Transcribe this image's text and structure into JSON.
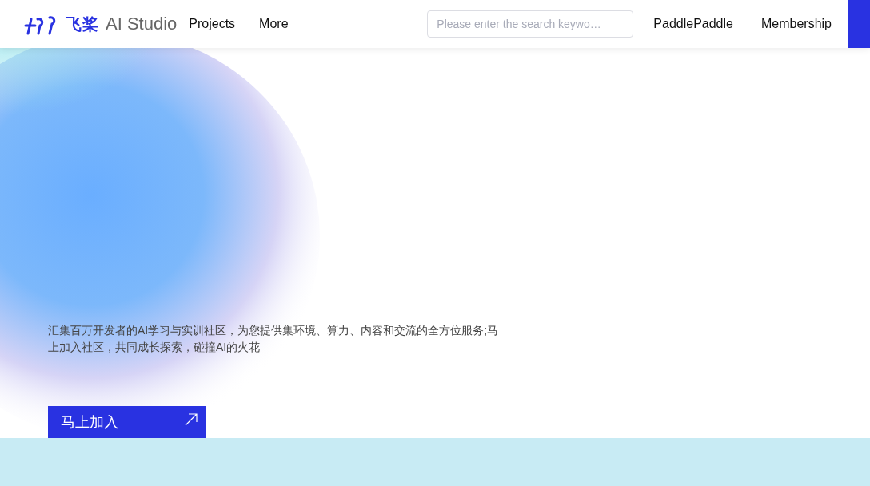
{
  "header": {
    "logo": {
      "brand": "飞桨",
      "product": "AI Studio"
    },
    "nav": [
      {
        "label": "Projects"
      },
      {
        "label": "More"
      }
    ],
    "search": {
      "placeholder": "Please enter the search keywo…"
    },
    "links": [
      {
        "label": "PaddlePaddle"
      },
      {
        "label": "Membership"
      }
    ]
  },
  "hero": {
    "description": "汇集百万开发者的AI学习与实训社区，为您提供集环境、算力、内容和交流的全方位服务;马上加入社区，共同成长探索，碰撞AI的火花",
    "button": {
      "label": "马上加入"
    }
  }
}
